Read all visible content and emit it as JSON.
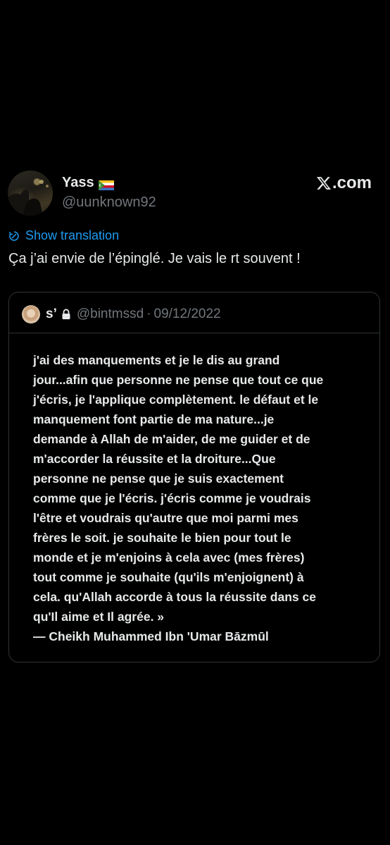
{
  "tweet": {
    "display_name": "Yass",
    "handle": "@uunknown92",
    "brand": ".com",
    "translate_label": "Show translation",
    "text": "Ça j’ai envie de l’épinglé. Je vais le rt souvent !"
  },
  "quoted": {
    "name": "s’",
    "handle": "@bintmssd",
    "separator": "·",
    "date": "09/12/2022",
    "lines": [
      "j'ai des manquements et je le dis au grand",
      "jour...afin que personne ne pense que tout ce que",
      "j'écris, je l'applique complètement. le défaut et le",
      "manquement font partie de ma nature...je",
      "demande à Allah de m'aider, de me guider et de",
      "m'accorder la réussite et la droiture...Que",
      "personne ne pense que je suis exactement",
      "comme que je l'écris. j'écris comme je voudrais",
      "l'être et voudrais qu'autre que moi parmi mes",
      "frères le soit. je souhaite le bien pour tout le",
      "monde et je m'enjoins à cela avec (mes frères)",
      "tout comme je souhaite (qu'ils m'enjoignent) à",
      "cela. qu'Allah accorde à tous la réussite dans ce",
      "qu'Il aime et Il agrée. »",
      "— Cheikh Muhammed Ibn 'Umar Bāzmūl"
    ]
  },
  "icons": {
    "flag": "comoros-flag-icon",
    "x_logo": "x-logo-icon",
    "translate": "translate-icon",
    "lock": "lock-icon"
  },
  "colors": {
    "background": "#000000",
    "text": "#e7e9ea",
    "muted": "#71767b",
    "link": "#1d9bf0",
    "border": "#2f3336"
  }
}
